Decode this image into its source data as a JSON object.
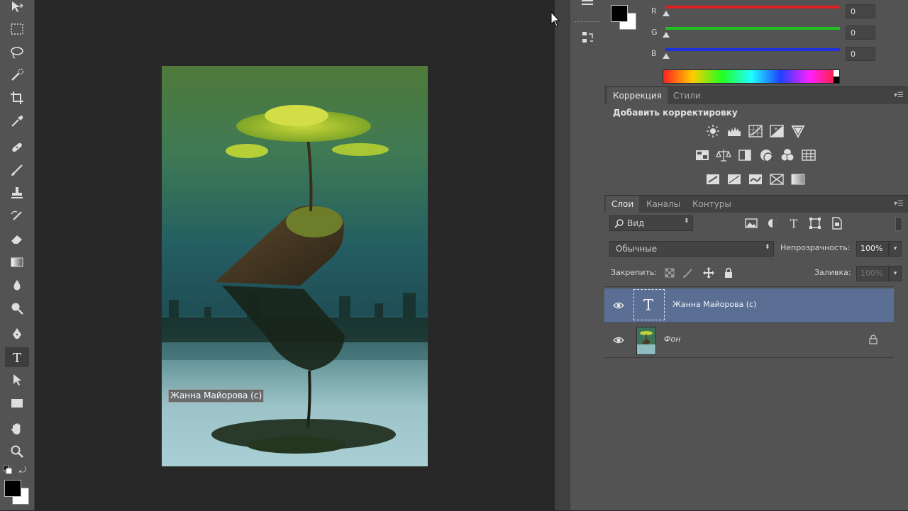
{
  "canvas": {
    "photo_text": "Жанна Майорова (c)"
  },
  "color_panel": {
    "channels": [
      {
        "label": "R",
        "value": "0",
        "color": "#e02020"
      },
      {
        "label": "G",
        "value": "0",
        "color": "#20c020"
      },
      {
        "label": "B",
        "value": "0",
        "color": "#2030e0"
      }
    ],
    "foreground_color": "#000000",
    "background_color": "#ffffff"
  },
  "adjustments_panel": {
    "tabs": [
      "Коррекция",
      "Стили"
    ],
    "heading": "Добавить корректировку",
    "icons_row1": [
      "brightness-icon",
      "levels-icon",
      "curves-icon",
      "exposure-icon",
      "vibrance-icon"
    ],
    "icons_row2": [
      "hue-saturation-icon",
      "color-balance-icon",
      "black-white-icon",
      "photo-filter-icon",
      "channel-mixer-icon",
      "color-lookup-icon"
    ],
    "icons_row3": [
      "invert-icon",
      "posterize-icon",
      "threshold-icon",
      "selective-color-icon",
      "gradient-map-icon"
    ]
  },
  "layers_panel": {
    "tabs": [
      "Слои",
      "Каналы",
      "Контуры"
    ],
    "filter_kind": "Вид",
    "blend_mode": "Обычные",
    "opacity_label": "Непрозрачность:",
    "opacity_value": "100%",
    "lock_label": "Закрепить:",
    "fill_label": "Заливка:",
    "fill_value": "100%",
    "layers": [
      {
        "name": "Жанна Майорова (с)",
        "type": "text",
        "selected": true,
        "locked": false
      },
      {
        "name": "Фон",
        "type": "image",
        "selected": false,
        "locked": true
      }
    ]
  }
}
